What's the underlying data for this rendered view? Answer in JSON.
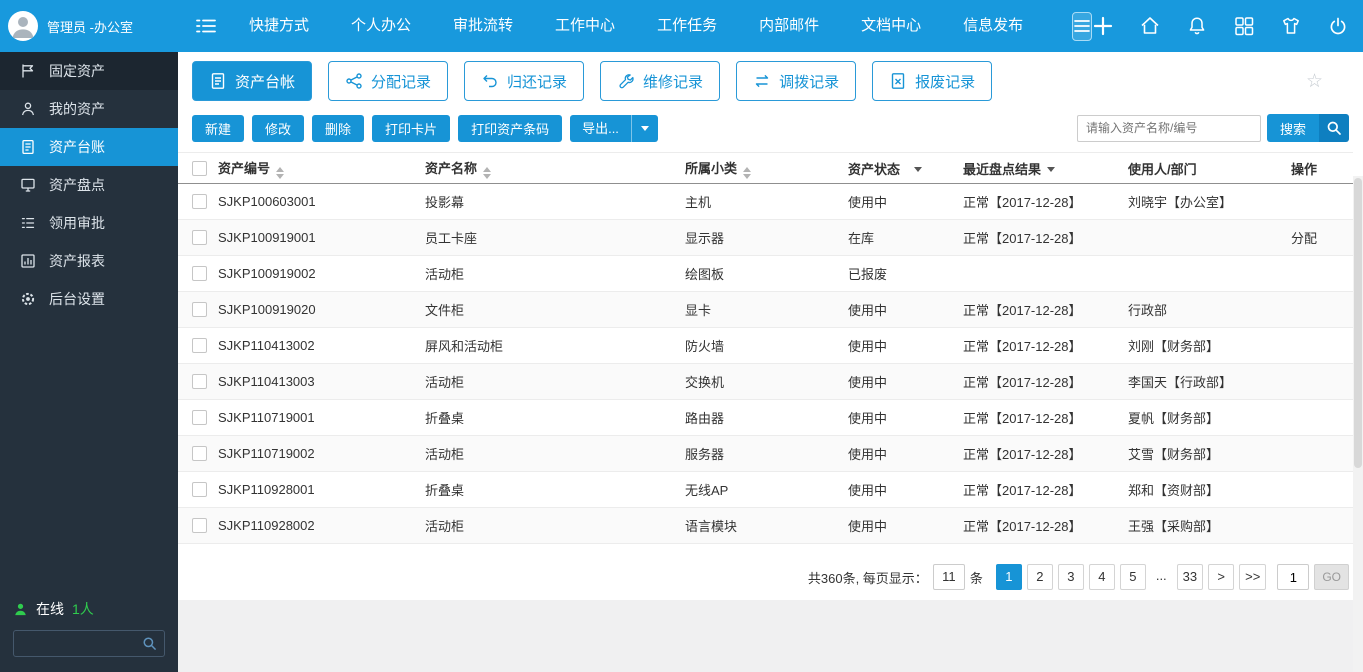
{
  "colors": {
    "primary": "#1794d6",
    "topbar": "#1899dd",
    "sidebar_bg": "#25313d",
    "sidebar_active": "#1794d6",
    "online_green": "#2fcc4e"
  },
  "topbar": {
    "user_label": "管理员 -办公室",
    "nav_items": [
      "快捷方式",
      "个人办公",
      "审批流转",
      "工作中心",
      "工作任务",
      "内部邮件",
      "文档中心",
      "信息发布"
    ]
  },
  "sidebar": {
    "items": [
      "固定资产",
      "我的资产",
      "资产台账",
      "资产盘点",
      "领用审批",
      "资产报表",
      "后台设置"
    ],
    "active_item": "资产台账",
    "online_prefix": "在线",
    "online_count": "1人",
    "search_value": ""
  },
  "tabs": [
    {
      "label": "资产台帐",
      "active": true
    },
    {
      "label": "分配记录",
      "active": false
    },
    {
      "label": "归还记录",
      "active": false
    },
    {
      "label": "维修记录",
      "active": false
    },
    {
      "label": "调拨记录",
      "active": false
    },
    {
      "label": "报废记录",
      "active": false
    }
  ],
  "toolbar": {
    "new": "新建",
    "edit": "修改",
    "delete": "删除",
    "print_card": "打印卡片",
    "print_barcode": "打印资产条码",
    "export": "导出...",
    "search_placeholder": "请输入资产名称/编号",
    "search_label": "搜索"
  },
  "table": {
    "headers": {
      "code": "资产编号",
      "name": "资产名称",
      "category": "所属小类",
      "status": "资产状态",
      "check": "最近盘点结果",
      "user": "使用人/部门",
      "action": "操作"
    },
    "rows": [
      {
        "code": "SJKP100603001",
        "name": "投影幕",
        "category": "主机",
        "status": "使用中",
        "check": "正常【2017-12-28】",
        "user": "刘晓宇【办公室】",
        "action": ""
      },
      {
        "code": "SJKP100919001",
        "name": "员工卡座",
        "category": "显示器",
        "status": "在库",
        "check": "正常【2017-12-28】",
        "user": "",
        "action": "分配"
      },
      {
        "code": "SJKP100919002",
        "name": "活动柜",
        "category": "绘图板",
        "status": "已报废",
        "check": "",
        "user": "",
        "action": ""
      },
      {
        "code": "SJKP100919020",
        "name": "文件柜",
        "category": "显卡",
        "status": "使用中",
        "check": "正常【2017-12-28】",
        "user": "行政部",
        "action": ""
      },
      {
        "code": "SJKP110413002",
        "name": "屏风和活动柜",
        "category": "防火墙",
        "status": "使用中",
        "check": "正常【2017-12-28】",
        "user": "刘刚【财务部】",
        "action": ""
      },
      {
        "code": "SJKP110413003",
        "name": "活动柜",
        "category": "交换机",
        "status": "使用中",
        "check": "正常【2017-12-28】",
        "user": "李国天【行政部】",
        "action": ""
      },
      {
        "code": "SJKP110719001",
        "name": "折叠桌",
        "category": "路由器",
        "status": "使用中",
        "check": "正常【2017-12-28】",
        "user": "夏帆【财务部】",
        "action": ""
      },
      {
        "code": "SJKP110719002",
        "name": "活动柜",
        "category": "服务器",
        "status": "使用中",
        "check": "正常【2017-12-28】",
        "user": "艾雪【财务部】",
        "action": ""
      },
      {
        "code": "SJKP110928001",
        "name": "折叠桌",
        "category": "无线AP",
        "status": "使用中",
        "check": "正常【2017-12-28】",
        "user": "郑和【资财部】",
        "action": ""
      },
      {
        "code": "SJKP110928002",
        "name": "活动柜",
        "category": "语言模块",
        "status": "使用中",
        "check": "正常【2017-12-28】",
        "user": "王强【采购部】",
        "action": ""
      }
    ]
  },
  "pagination": {
    "summary": "共360条, 每页显示：",
    "page_size": "11",
    "unit": "条",
    "pages": [
      "1",
      "2",
      "3",
      "4",
      "5",
      "...",
      "33"
    ],
    "active_page": "1",
    "next": ">",
    "last": ">>",
    "goto_value": "1",
    "go_label": "GO"
  }
}
